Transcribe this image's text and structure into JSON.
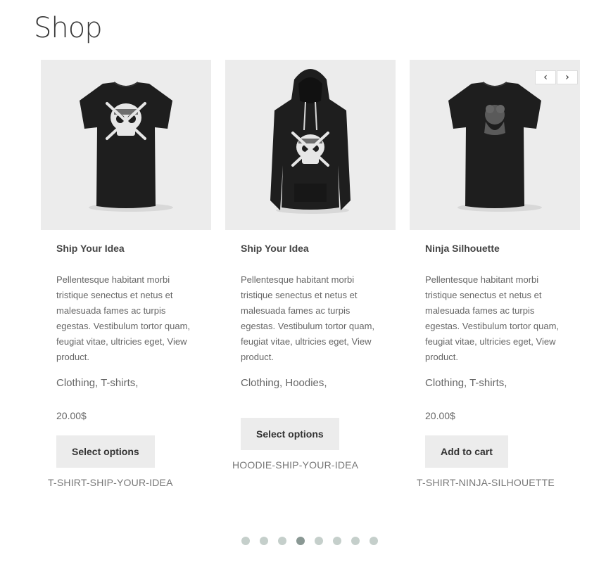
{
  "page": {
    "title": "Shop"
  },
  "carousel": {
    "prev_icon": "chevron-left-icon",
    "next_icon": "chevron-right-icon",
    "prev_glyph": "‹",
    "next_glyph": "›",
    "dot_count": 8,
    "active_dot": 4,
    "products": [
      {
        "name": "Ship Your Idea",
        "image": "black-tshirt-skull-image",
        "description": "Pellentesque habitant morbi tristique senectus et netus et malesuada fames ac turpis egestas. Vestibulum tortor quam, feugiat vitae, ultricies eget, View product.",
        "categories": "Clothing, T-shirts,",
        "price": "20.00$",
        "button_label": "Select options",
        "sku": "T-SHIRT-SHIP-YOUR-IDEA"
      },
      {
        "name": "Ship Your Idea",
        "image": "black-hoodie-skull-image",
        "description": "Pellentesque habitant morbi tristique senectus et netus et malesuada fames ac turpis egestas. Vestibulum tortor quam, feugiat vitae, ultricies eget, View product.",
        "categories": "Clothing, Hoodies,",
        "price": "",
        "button_label": "Select options",
        "sku": "HOODIE-SHIP-YOUR-IDEA"
      },
      {
        "name": "Ninja Silhouette",
        "image": "black-tshirt-ninja-image",
        "description": "Pellentesque habitant morbi tristique senectus et netus et malesuada fames ac turpis egestas. Vestibulum tortor quam, feugiat vitae, ultricies eget, View product.",
        "categories": "Clothing, T-shirts,",
        "price": "20.00$",
        "button_label": "Add to cart",
        "sku": "T-SHIRT-NINJA-SILHOUETTE"
      }
    ]
  },
  "colors": {
    "image_bg": "#ececec",
    "button_bg": "#ececec",
    "dot_inactive": "#c5cfcb",
    "dot_active": "#8a9894",
    "garment": "#1e1e1e"
  }
}
